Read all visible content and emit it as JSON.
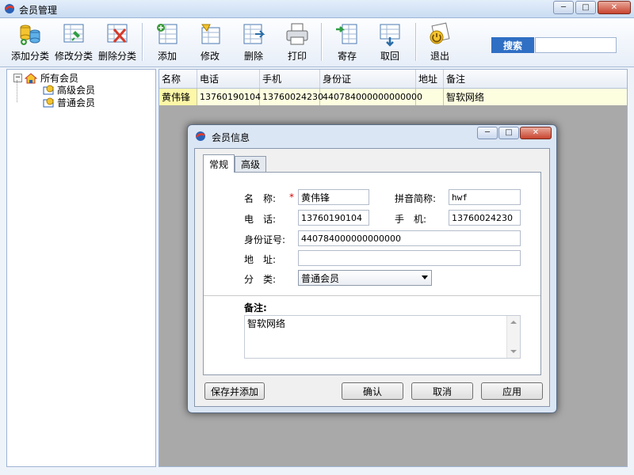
{
  "window": {
    "title": "会员管理"
  },
  "toolbar": {
    "add_category": "添加分类",
    "edit_category": "修改分类",
    "delete_category": "删除分类",
    "add": "添加",
    "edit": "修改",
    "delete": "删除",
    "print": "打印",
    "deposit": "寄存",
    "retrieve": "取回",
    "exit": "退出",
    "search_label": "搜索",
    "search_value": ""
  },
  "tree": {
    "root": "所有会员",
    "children": [
      "高级会员",
      "普通会员"
    ]
  },
  "table": {
    "headers": [
      "名称",
      "电话",
      "手机",
      "身份证",
      "地址",
      "备注"
    ],
    "rows": [
      [
        "黄伟锋",
        "13760190104",
        "13760024230",
        "440784000000000000",
        "",
        "智软网络"
      ]
    ]
  },
  "dialog": {
    "title": "会员信息",
    "tabs": [
      "常规",
      "高级"
    ],
    "name_label": "名　称:",
    "name_required": "*",
    "name_value": "黄伟锋",
    "pinyin_label": "拼音简称:",
    "pinyin_value": "hwf",
    "phone_label": "电　话:",
    "phone_value": "13760190104",
    "mobile_label": "手　机:",
    "mobile_value": "13760024230",
    "idcard_label": "身份证号:",
    "idcard_value": "440784000000000000",
    "address_label": "地　址:",
    "address_value": "",
    "category_label": "分　类:",
    "category_value": "普通会员",
    "note_label": "备注:",
    "note_value": "智软网络",
    "save_add_button": "保存并添加",
    "ok_button": "确认",
    "cancel_button": "取消",
    "apply_button": "应用"
  },
  "colors": {
    "titlebar": "#c9dcf2",
    "search_bg": "#2f6fc4",
    "selected_row": "#fdfde0",
    "grid_bg": "#a9a9a9"
  }
}
